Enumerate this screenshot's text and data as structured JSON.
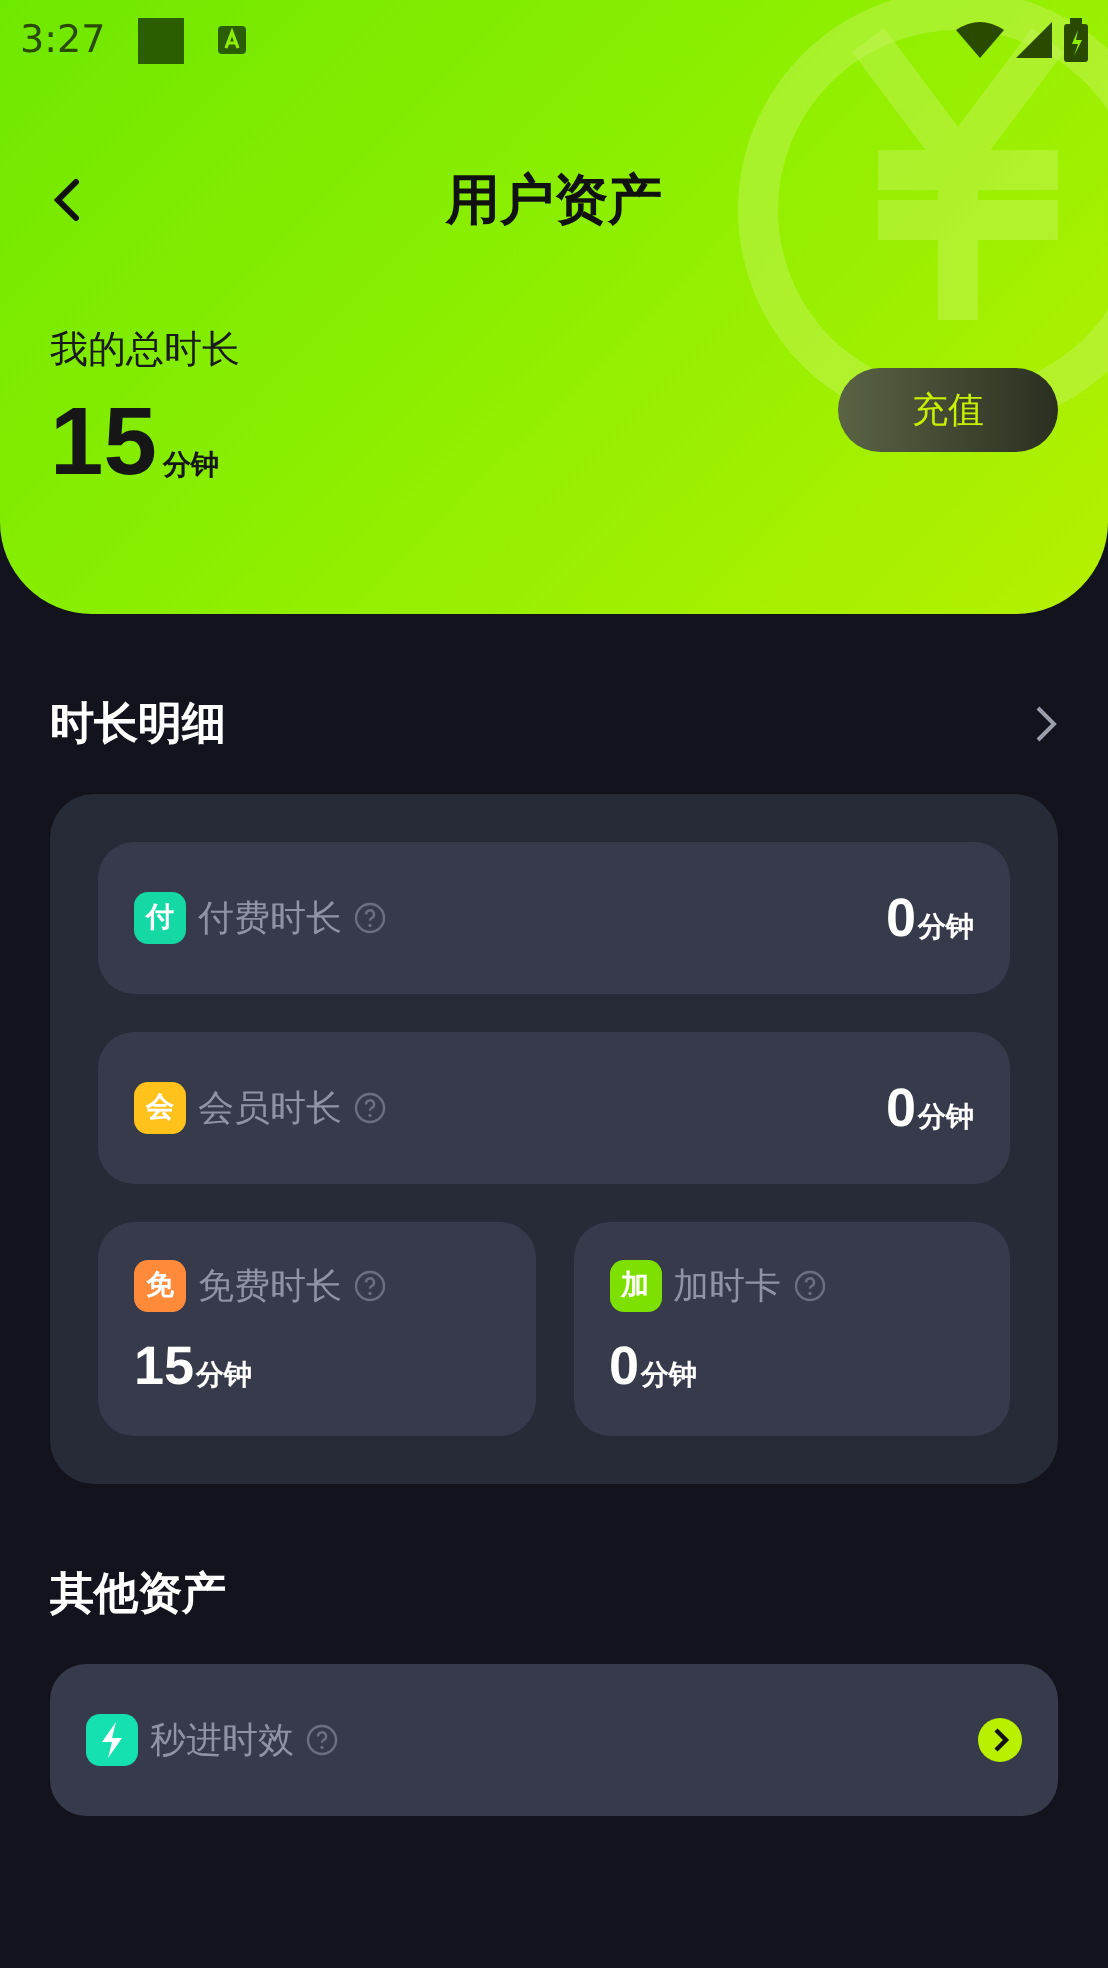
{
  "status_bar": {
    "time": "3:27"
  },
  "header": {
    "title": "用户资产",
    "total_label": "我的总时长",
    "total_value": "15",
    "total_unit": "分钟",
    "recharge_button": "充值"
  },
  "duration_section": {
    "title": "时长明细",
    "items": [
      {
        "kind": "wide",
        "badge": "付",
        "color": "#14d9a5",
        "label": "付费时长",
        "value": "0",
        "unit": "分钟"
      },
      {
        "kind": "wide",
        "badge": "会",
        "color": "#ffc21a",
        "label": "会员时长",
        "value": "0",
        "unit": "分钟"
      },
      {
        "kind": "half",
        "badge": "免",
        "color": "#ff8a3a",
        "label": "免费时长",
        "value": "15",
        "unit": "分钟"
      },
      {
        "kind": "half",
        "badge": "加",
        "color": "#7ee000",
        "label": "加时卡",
        "value": "0",
        "unit": "分钟"
      }
    ]
  },
  "other_section": {
    "title": "其他资产",
    "items": [
      {
        "label": "秒进时效",
        "color": "#14e0b0"
      }
    ]
  }
}
